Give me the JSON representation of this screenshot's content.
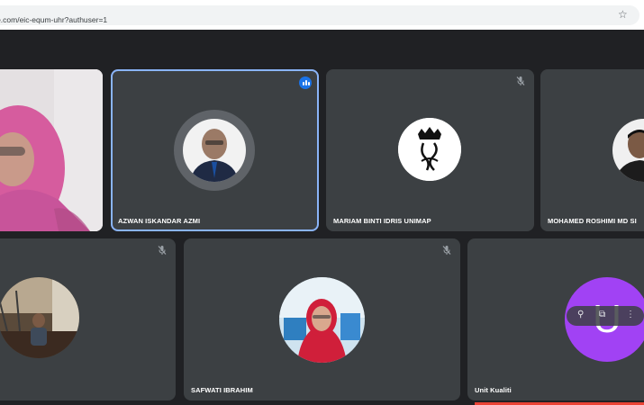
{
  "browser": {
    "url": "oogle.com/eic-equm-uhr?authuser=1"
  },
  "participants": [
    {
      "name": ""
    },
    {
      "name": "AZWAN ISKANDAR AZMI"
    },
    {
      "name": "MARIAM BINTI IDRIS UNIMAP"
    },
    {
      "name": "MOHAMED ROSHIMI MD SI"
    },
    {
      "name": ""
    },
    {
      "name": "SAFWATI IBRAHIM"
    },
    {
      "name": "Unit Kualiti",
      "initial": "U"
    }
  ],
  "colors": {
    "tile": "#3c4043",
    "background": "#202124",
    "active_border": "#8ab4f8",
    "speaking": "#1a73e8",
    "avatar_u": "#a142f4"
  },
  "icons": {
    "bookmark": "star-icon",
    "muted": "mic-off-icon",
    "speaking": "audio-bars-icon",
    "pin": "pin-icon",
    "pip": "picture-in-picture-icon",
    "more": "more-vert-icon"
  }
}
